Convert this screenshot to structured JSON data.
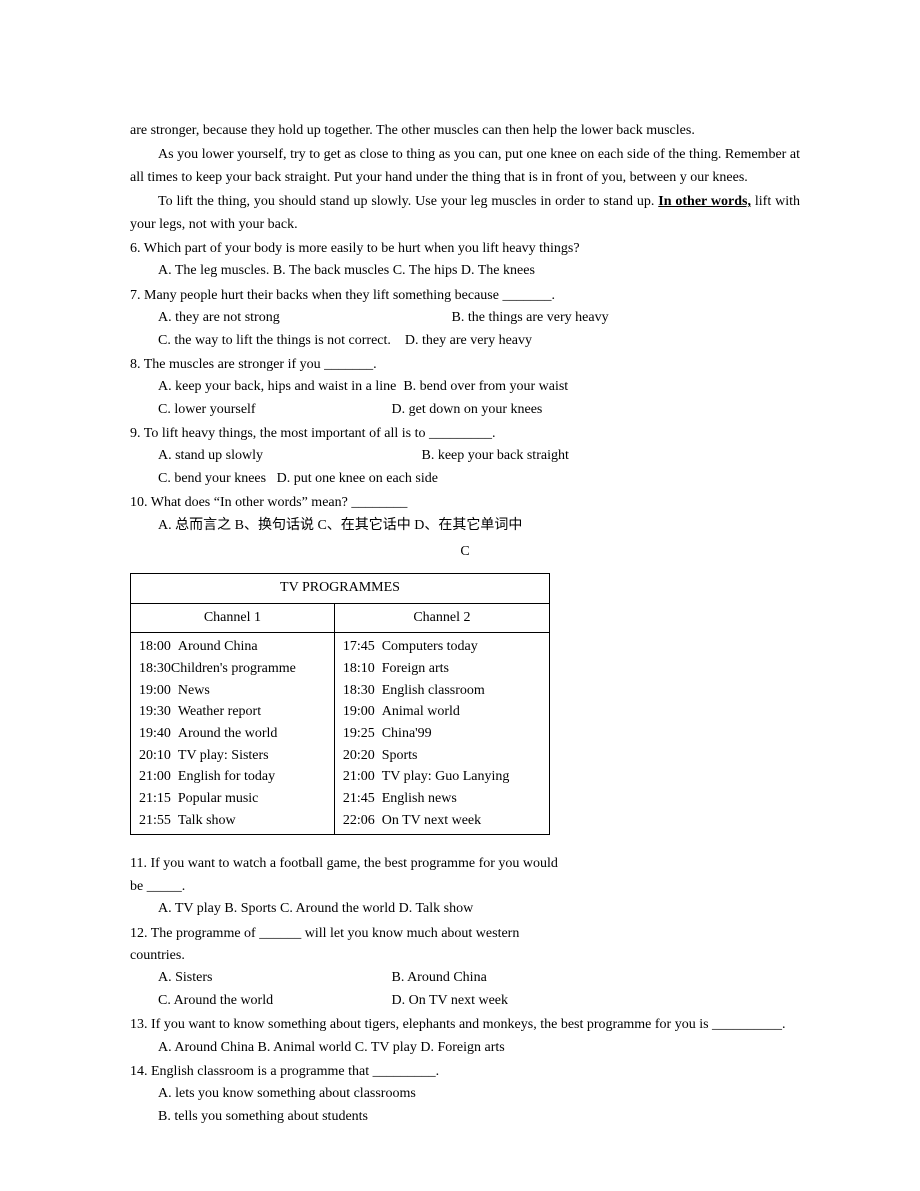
{
  "passage": {
    "p1": "are stronger, because they hold up together. The other muscles can then help the lower back muscles.",
    "p2": "As you lower yourself, try to get as close to thing as you can, put one knee on each side of the thing. Remember at all times to keep your back straight. Put your hand under the thing that is in front of you, between y our knees.",
    "p3_pre": "To lift the thing, you should stand up slowly. Use your leg muscles in order to stand up. ",
    "p3_u": "In other words,",
    "p3_post": " lift with your legs, not with your back."
  },
  "q6": {
    "stem": "6. Which part of your body is more easily to be hurt when you lift heavy things?",
    "opts": "A. The leg muscles.  B. The back muscles   C. The hips   D. The knees"
  },
  "q7": {
    "stem": "7. Many people hurt their backs when they lift something because _______.",
    "optA": "A. they are not strong",
    "optB": "B. the things are very heavy",
    "optC": "C. the way to lift the things is not correct.",
    "optD": "D. they are very heavy"
  },
  "q8": {
    "stem": "8. The muscles are stronger if you _______.",
    "optA": "A. keep your back, hips and waist in a line",
    "optB": "B. bend over from your waist",
    "optC": "C. lower yourself",
    "optD": "D. get down on your knees"
  },
  "q9": {
    "stem": "9. To lift heavy things, the most important of all is to _________.",
    "optA": "A. stand up slowly",
    "optB": "B. keep your back straight",
    "optC": "C. bend your knees",
    "optD": "D. put one knee on each side"
  },
  "q10": {
    "stem": "10. What does “In other words” mean? ________",
    "opts": "A. 总而言之   B、换句话说   C、在其它话中   D、在其它单词中"
  },
  "centered_c": "C",
  "tv_table": {
    "title": "TV PROGRAMMES",
    "ch1_header": "Channel 1",
    "ch2_header": "Channel 2",
    "ch1": [
      {
        "time": "18:00",
        "prog": "Around China"
      },
      {
        "time": "18:30",
        "prog": "Children's programme"
      },
      {
        "time": "19:00",
        "prog": "News"
      },
      {
        "time": "19:30",
        "prog": "Weather report"
      },
      {
        "time": "19:40",
        "prog": "Around the world"
      },
      {
        "time": "20:10",
        "prog": "TV play: Sisters"
      },
      {
        "time": "21:00",
        "prog": "English for today"
      },
      {
        "time": "21:15",
        "prog": "Popular music"
      },
      {
        "time": "21:55",
        "prog": "Talk show"
      }
    ],
    "ch2": [
      {
        "time": "17:45",
        "prog": "Computers today"
      },
      {
        "time": "18:10",
        "prog": "Foreign arts"
      },
      {
        "time": "18:30",
        "prog": "English classroom"
      },
      {
        "time": "19:00",
        "prog": "Animal world"
      },
      {
        "time": "19:25",
        "prog": "China'99"
      },
      {
        "time": "20:20",
        "prog": "Sports"
      },
      {
        "time": "21:00",
        "prog": "TV play: Guo Lanying"
      },
      {
        "time": "21:45",
        "prog": "English news"
      },
      {
        "time": "22:06",
        "prog": "On TV next week"
      }
    ]
  },
  "q11": {
    "stem_a": "11. If you want to watch a football game, the best programme for you would",
    "stem_b": "be _____.",
    "opts": "A. TV play   B. Sports   C. Around the world   D. Talk show"
  },
  "q12": {
    "stem_a": "12. The programme of ______ will let you know much about western",
    "stem_b": "countries.",
    "optA": "A. Sisters",
    "optB": "B. Around China",
    "optC": "C. Around the world",
    "optD": "D. On TV next week"
  },
  "q13": {
    "stem": "13. If you want to know something about tigers, elephants and monkeys, the best programme for you is __________.",
    "opts": "A. Around China   B. Animal world   C. TV play   D. Foreign arts"
  },
  "q14": {
    "stem": "14. English classroom is a programme that _________.",
    "optA": "A. lets you know something about classrooms",
    "optB": "B. tells you something about students"
  }
}
